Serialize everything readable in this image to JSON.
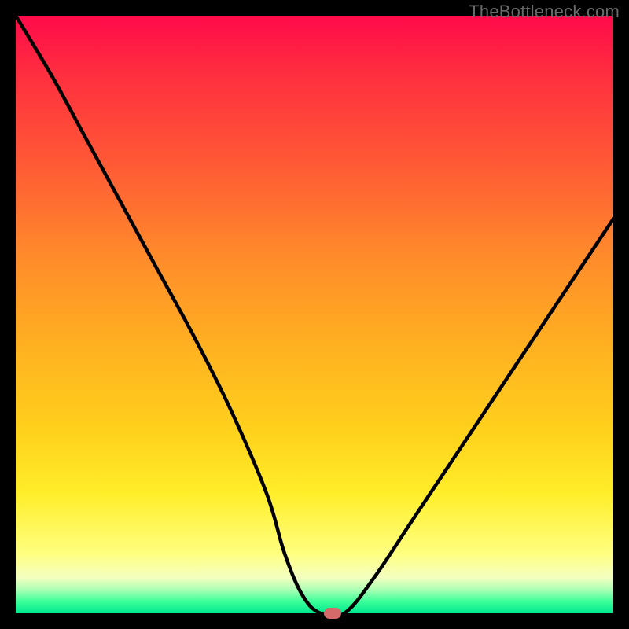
{
  "watermark": "TheBottleneck.com",
  "chart_data": {
    "type": "line",
    "title": "",
    "xlabel": "",
    "ylabel": "",
    "xlim": [
      0,
      100
    ],
    "ylim": [
      0,
      100
    ],
    "grid": false,
    "legend": false,
    "series": [
      {
        "name": "bottleneck-curve",
        "x": [
          0,
          6,
          12,
          18,
          24,
          30,
          36,
          42,
          45,
          48,
          51,
          55,
          60,
          66,
          72,
          78,
          84,
          90,
          96,
          100
        ],
        "values": [
          100,
          90,
          79,
          68,
          57,
          46,
          34,
          20,
          10,
          3,
          0,
          0,
          6,
          15,
          24,
          33,
          42,
          51,
          60,
          66
        ]
      }
    ],
    "annotations": [
      {
        "name": "minimum-marker",
        "x": 53,
        "y": 0,
        "shape": "pill",
        "color": "#d46a6a"
      }
    ],
    "background_gradient": {
      "direction": "vertical",
      "stops": [
        {
          "pos": 0.0,
          "color": "#ff0a4a"
        },
        {
          "pos": 0.4,
          "color": "#ff8a2b"
        },
        {
          "pos": 0.8,
          "color": "#ffee2a"
        },
        {
          "pos": 0.94,
          "color": "#f4ffc0"
        },
        {
          "pos": 1.0,
          "color": "#00e88f"
        }
      ]
    }
  }
}
